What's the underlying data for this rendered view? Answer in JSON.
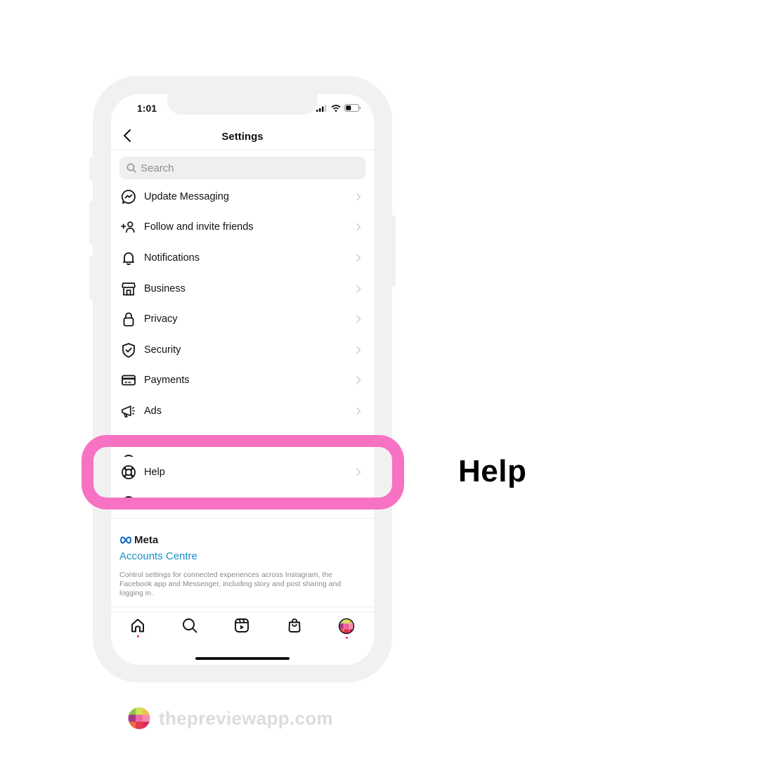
{
  "status_bar": {
    "time": "1:01"
  },
  "header": {
    "title": "Settings",
    "back_icon": "chevron-left-icon"
  },
  "search": {
    "placeholder": "Search",
    "value": ""
  },
  "menu": {
    "items": [
      {
        "label": "Update Messaging",
        "icon": "messenger-icon"
      },
      {
        "label": "Follow and invite friends",
        "icon": "add-person-icon"
      },
      {
        "label": "Notifications",
        "icon": "bell-icon"
      },
      {
        "label": "Business",
        "icon": "storefront-icon"
      },
      {
        "label": "Privacy",
        "icon": "lock-icon"
      },
      {
        "label": "Security",
        "icon": "shield-check-icon"
      },
      {
        "label": "Payments",
        "icon": "credit-card-icon"
      },
      {
        "label": "Ads",
        "icon": "megaphone-icon"
      },
      {
        "label": "Help",
        "icon": "lifebuoy-icon"
      }
    ]
  },
  "meta": {
    "brand": "Meta",
    "accounts_centre": "Accounts Centre",
    "description": "Control settings for connected experiences across Instagram, the Facebook app and Messenger, including story and post sharing and logging in."
  },
  "tab_bar": {
    "tabs": [
      {
        "name": "home",
        "icon": "home-icon",
        "has_dot": true
      },
      {
        "name": "search",
        "icon": "search-icon",
        "has_dot": false
      },
      {
        "name": "reels",
        "icon": "reels-icon",
        "has_dot": false
      },
      {
        "name": "shop",
        "icon": "shopping-bag-icon",
        "has_dot": false
      },
      {
        "name": "profile",
        "icon": "profile-avatar",
        "has_dot": true
      }
    ]
  },
  "callout": {
    "label": "Help",
    "highlight_color": "#f772c3"
  },
  "watermark": {
    "text": "thepreviewapp.com"
  },
  "colors": {
    "accent_link": "#1a8fc4",
    "notification_dot": "#d6336c"
  }
}
